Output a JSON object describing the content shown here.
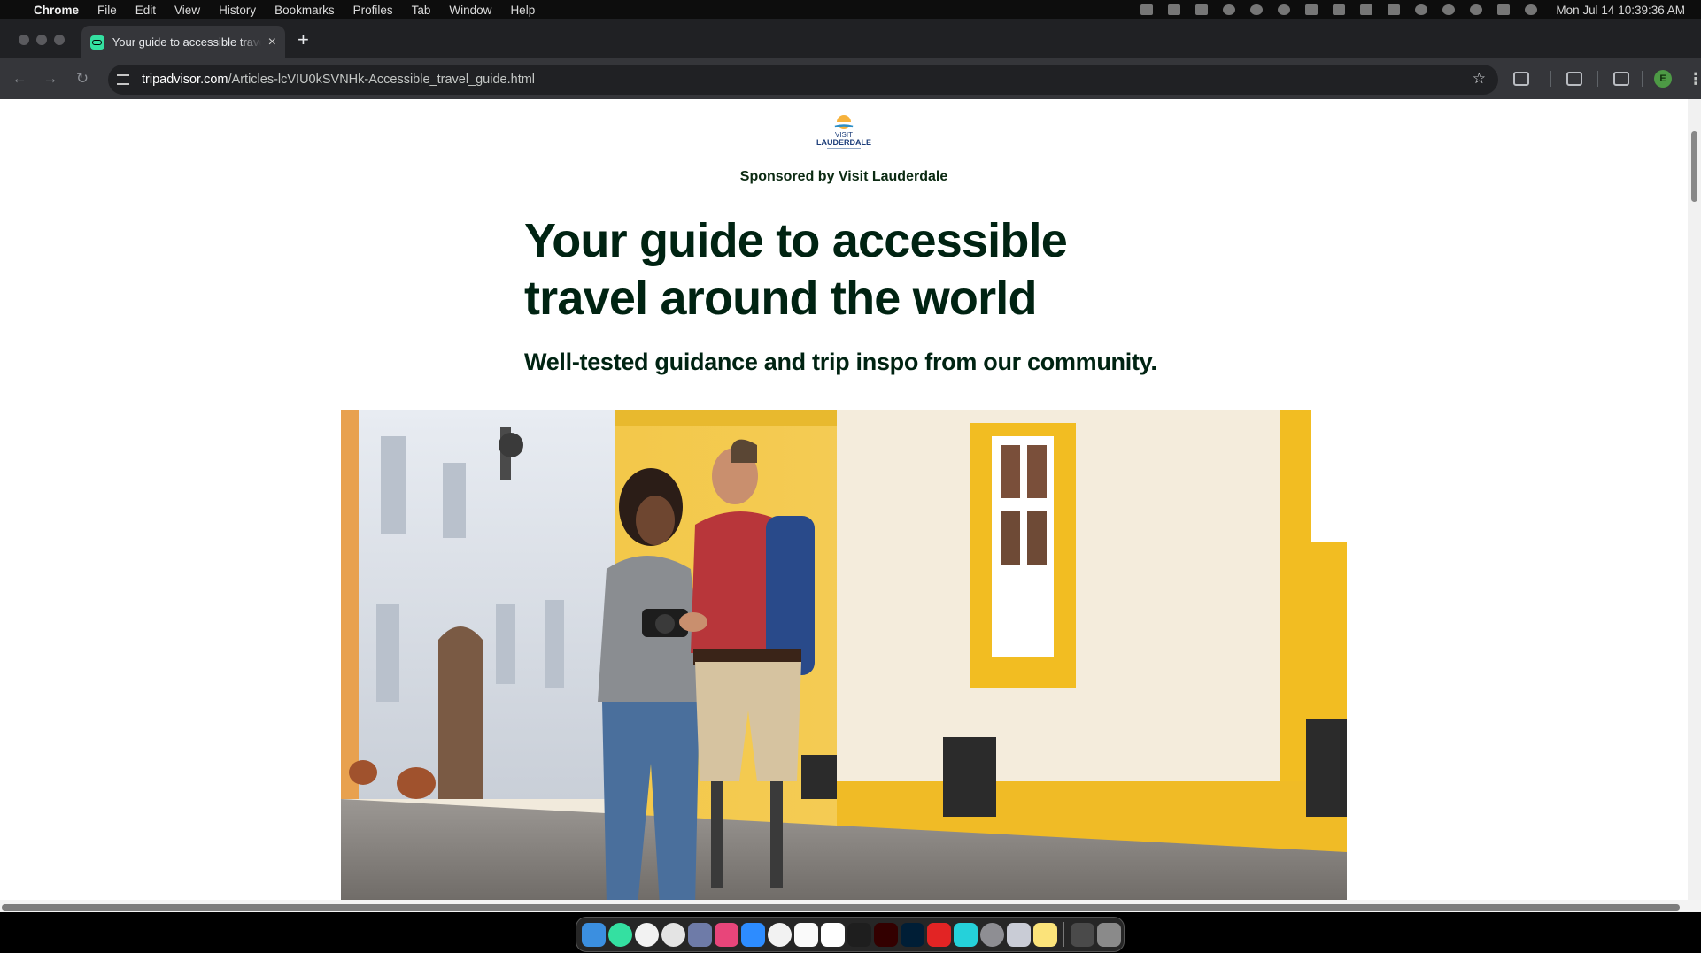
{
  "menubar": {
    "app_name": "Chrome",
    "menus": [
      "File",
      "Edit",
      "View",
      "History",
      "Bookmarks",
      "Profiles",
      "Tab",
      "Window",
      "Help"
    ],
    "clock": "Mon Jul 14  10:39:36 AM"
  },
  "browser": {
    "tab_title": "Your guide to accessible travel around the world",
    "url_host": "tripadvisor.com",
    "url_path": "/Articles-lcVIU0kSVNHk-Accessible_travel_guide.html",
    "profile_initial": "E"
  },
  "page": {
    "logo_line1": "VISIT",
    "logo_line2": "LAUDERDALE",
    "sponsor": "Sponsored by Visit Lauderdale",
    "headline_line1": "Your guide to accessible",
    "headline_line2": "travel around the world",
    "subhead": "Well-tested guidance and trip inspo from our community."
  },
  "colors": {
    "headline": "#002312",
    "brand_green": "#34e0a1",
    "facade_yellow": "#f4c230",
    "facade_white": "#d9dde4"
  },
  "dock": {
    "apps": [
      "finder-icon",
      "tripadvisor-icon",
      "wifi-icon",
      "clock-icon",
      "launchpad-icon",
      "photos-icon",
      "zoom-icon",
      "chrome-icon",
      "slack-icon",
      "drive-icon",
      "figma-icon",
      "illustrator-icon",
      "lightroom-icon",
      "acrobat-icon",
      "amazon-music-icon",
      "system-settings-icon",
      "screenshot-icon",
      "notes-icon",
      "keyboard-icon",
      "trash-icon"
    ]
  }
}
